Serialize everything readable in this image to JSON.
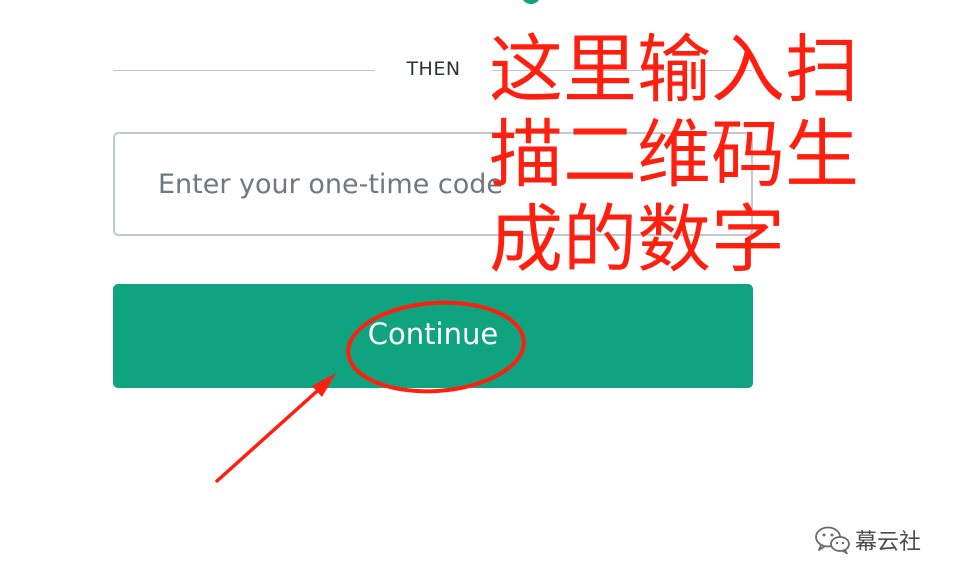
{
  "form": {
    "divider_label": "THEN",
    "otp_input": {
      "placeholder": "Enter your one-time code",
      "value": ""
    },
    "continue_label": "Continue"
  },
  "annotation": {
    "text": "这里输入扫描二维码生成的数字",
    "highlight_target": "continue-button"
  },
  "watermark": {
    "text": "幕云社",
    "icon": "wechat-icon"
  },
  "colors": {
    "brand": "#10a37f",
    "annotation": "#ff1f0f",
    "border": "#c2c8d0",
    "text": "#2d333a",
    "placeholder": "#6f7780"
  }
}
